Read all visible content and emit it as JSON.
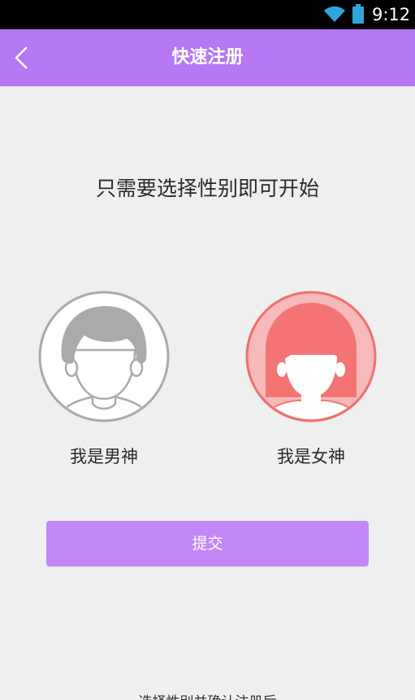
{
  "status_bar": {
    "time": "9:12",
    "icons": [
      "wifi-icon",
      "battery-icon"
    ]
  },
  "header": {
    "title": "快速注册",
    "back_icon": "chevron-left-icon",
    "background_color": "#b677f2"
  },
  "prompt": "只需要选择性别即可开始",
  "options": {
    "male": {
      "label": "我是男神",
      "icon": "male-avatar-icon",
      "color": "#a9a9a9"
    },
    "female": {
      "label": "我是女神",
      "icon": "female-avatar-icon",
      "color": "#f47474"
    }
  },
  "submit": {
    "label": "提交",
    "color": "#c388f7"
  },
  "footer_note": "选择性别并确认注册后"
}
